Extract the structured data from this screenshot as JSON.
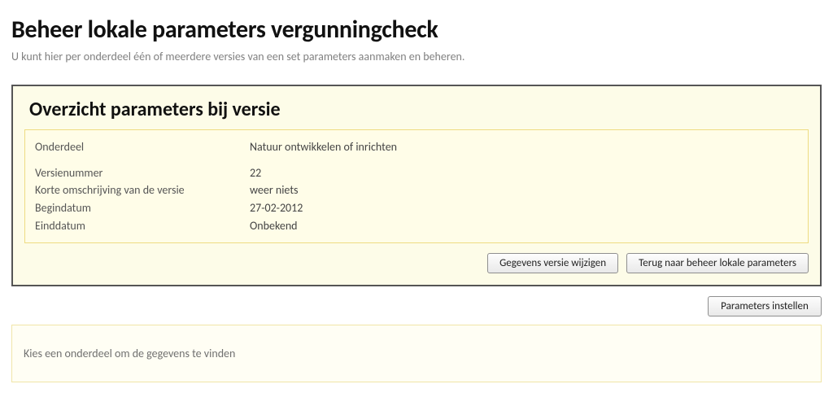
{
  "header": {
    "title": "Beheer lokale parameters vergunningcheck",
    "subtitle": "U kunt hier per onderdeel één of meerdere versies van een set parameters aanmaken en beheren."
  },
  "overview": {
    "title": "Overzicht parameters bij versie",
    "rows": {
      "onderdeel": {
        "label": "Onderdeel",
        "value": "Natuur ontwikkelen of inrichten"
      },
      "versienummer": {
        "label": "Versienummer",
        "value": "22"
      },
      "korte_omschrijving": {
        "label": "Korte omschrijving van de versie",
        "value": "weer niets"
      },
      "begindatum": {
        "label": "Begindatum",
        "value": "27-02-2012"
      },
      "einddatum": {
        "label": "Einddatum",
        "value": "Onbekend"
      }
    },
    "buttons": {
      "wijzigen": "Gegevens versie wijzigen",
      "terug": "Terug naar beheer lokale parameters"
    }
  },
  "actions": {
    "parameters_instellen": "Parameters instellen"
  },
  "hint": {
    "text": "Kies een onderdeel om de gegevens te vinden"
  }
}
